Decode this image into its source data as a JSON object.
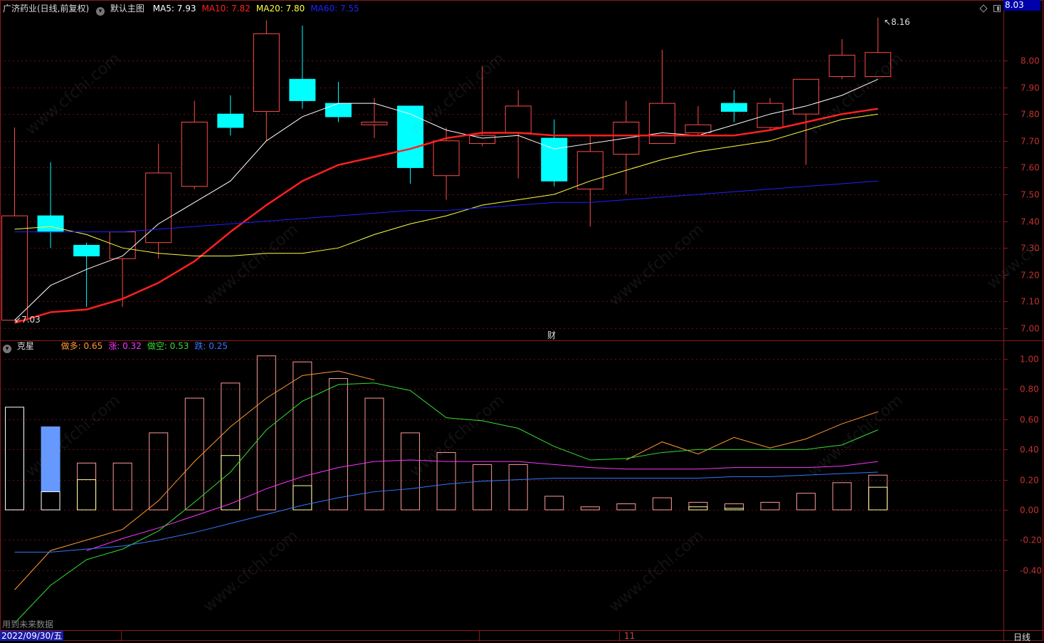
{
  "header": {
    "stock": "广济药业(日线,前复权)",
    "template_label": "默认主图",
    "ma": [
      {
        "label": "MA5: 7.93",
        "color": "#ffffff"
      },
      {
        "label": "MA10: 7.82",
        "color": "#ff2020"
      },
      {
        "label": "MA20: 7.80",
        "color": "#ffff40"
      },
      {
        "label": "MA60: 7.55",
        "color": "#2020ff"
      }
    ]
  },
  "sub_header": {
    "name": "克星",
    "items": [
      {
        "label": "做多: 0.65",
        "color": "#ff9933"
      },
      {
        "label": "涨: 0.32",
        "color": "#ff33ff"
      },
      {
        "label": "做空: 0.53",
        "color": "#33dd33"
      },
      {
        "label": "跌: 0.25",
        "color": "#3377ff"
      }
    ]
  },
  "markers": {
    "high_label": "8.16",
    "low_label": "7.03",
    "current_price": "8.03",
    "finance_mark": "财",
    "future_data_note": "用到未来数据",
    "date": "2022/09/30/五",
    "month_mark": "11",
    "period": "日线"
  },
  "chart_data": [
    {
      "type": "candlestick",
      "title": "广济药业(日线,前复权)",
      "ylim": [
        6.97,
        8.24
      ],
      "y_ticks": [
        "8.00",
        "7.90",
        "7.80",
        "7.70",
        "7.60",
        "7.50",
        "7.40",
        "7.30",
        "7.20",
        "7.10",
        "7.00"
      ],
      "candles": [
        {
          "o": 7.03,
          "h": 7.75,
          "l": 7.03,
          "c": 7.42
        },
        {
          "o": 7.42,
          "h": 7.62,
          "l": 7.3,
          "c": 7.36
        },
        {
          "o": 7.31,
          "h": 7.32,
          "l": 7.08,
          "c": 7.27
        },
        {
          "o": 7.26,
          "h": 7.36,
          "l": 7.08,
          "c": 7.36
        },
        {
          "o": 7.32,
          "h": 7.69,
          "l": 7.26,
          "c": 7.58
        },
        {
          "o": 7.53,
          "h": 7.85,
          "l": 7.52,
          "c": 7.77
        },
        {
          "o": 7.8,
          "h": 7.87,
          "l": 7.72,
          "c": 7.75
        },
        {
          "o": 7.81,
          "h": 8.15,
          "l": 7.7,
          "c": 8.1
        },
        {
          "o": 7.93,
          "h": 8.13,
          "l": 7.82,
          "c": 7.85
        },
        {
          "o": 7.84,
          "h": 7.92,
          "l": 7.77,
          "c": 7.79
        },
        {
          "o": 7.76,
          "h": 7.86,
          "l": 7.71,
          "c": 7.77
        },
        {
          "o": 7.83,
          "h": 7.83,
          "l": 7.54,
          "c": 7.6
        },
        {
          "o": 7.57,
          "h": 7.75,
          "l": 7.48,
          "c": 7.7
        },
        {
          "o": 7.69,
          "h": 7.98,
          "l": 7.68,
          "c": 7.72
        },
        {
          "o": 7.73,
          "h": 7.89,
          "l": 7.56,
          "c": 7.83
        },
        {
          "o": 7.71,
          "h": 7.78,
          "l": 7.53,
          "c": 7.55
        },
        {
          "o": 7.52,
          "h": 7.72,
          "l": 7.38,
          "c": 7.66
        },
        {
          "o": 7.65,
          "h": 7.85,
          "l": 7.5,
          "c": 7.77
        },
        {
          "o": 7.69,
          "h": 8.04,
          "l": 7.69,
          "c": 7.84
        },
        {
          "o": 7.73,
          "h": 7.83,
          "l": 7.72,
          "c": 7.76
        },
        {
          "o": 7.84,
          "h": 7.89,
          "l": 7.77,
          "c": 7.81
        },
        {
          "o": 7.75,
          "h": 7.86,
          "l": 7.74,
          "c": 7.84
        },
        {
          "o": 7.8,
          "h": 7.93,
          "l": 7.61,
          "c": 7.93
        },
        {
          "o": 7.94,
          "h": 8.08,
          "l": 7.93,
          "c": 8.02
        },
        {
          "o": 7.94,
          "h": 8.16,
          "l": 7.94,
          "c": 8.03
        }
      ],
      "ma": [
        {
          "name": "MA5",
          "color": "#ffffff",
          "width": 1,
          "values": [
            7.03,
            7.16,
            7.22,
            7.27,
            7.39,
            7.47,
            7.55,
            7.7,
            7.79,
            7.84,
            7.84,
            7.8,
            7.74,
            7.71,
            7.72,
            7.67,
            7.69,
            7.71,
            7.73,
            7.72,
            7.76,
            7.8,
            7.83,
            7.87,
            7.93
          ]
        },
        {
          "name": "MA10",
          "color": "#ff2020",
          "width": 2.5,
          "values": [
            7.02,
            7.06,
            7.07,
            7.11,
            7.17,
            7.25,
            7.36,
            7.46,
            7.55,
            7.61,
            7.64,
            7.67,
            7.71,
            7.73,
            7.73,
            7.72,
            7.72,
            7.72,
            7.72,
            7.72,
            7.72,
            7.74,
            7.77,
            7.8,
            7.82
          ]
        },
        {
          "name": "MA20",
          "color": "#ffff40",
          "width": 1,
          "values": [
            7.37,
            7.38,
            7.35,
            7.3,
            7.28,
            7.27,
            7.27,
            7.28,
            7.28,
            7.3,
            7.35,
            7.39,
            7.42,
            7.46,
            7.48,
            7.5,
            7.55,
            7.59,
            7.63,
            7.66,
            7.68,
            7.7,
            7.74,
            7.78,
            7.8
          ]
        },
        {
          "name": "MA60",
          "color": "#2020ff",
          "width": 1,
          "values": [
            7.36,
            7.36,
            7.36,
            7.36,
            7.37,
            7.38,
            7.39,
            7.4,
            7.41,
            7.42,
            7.43,
            7.44,
            7.44,
            7.45,
            7.46,
            7.47,
            7.47,
            7.48,
            7.49,
            7.5,
            7.51,
            7.52,
            7.53,
            7.54,
            7.55
          ]
        }
      ]
    },
    {
      "type": "bar+line",
      "title": "克星",
      "ylim": [
        -0.42,
        1.07
      ],
      "y_ticks": [
        "1.00",
        "0.80",
        "0.60",
        "0.40",
        "0.20",
        "0.00",
        "-0.20",
        "-0.40"
      ],
      "bars": [
        {
          "v": 0.68,
          "inner": null,
          "color": "#ffffff",
          "fill": false
        },
        {
          "v": 0.55,
          "inner": 0.12,
          "color": "#6699ff",
          "fill": true
        },
        {
          "v": 0.31,
          "inner": 0.2,
          "color": "#ff9999",
          "fill": false
        },
        {
          "v": 0.31,
          "inner": null,
          "color": "#ff9999",
          "fill": false
        },
        {
          "v": 0.51,
          "inner": null,
          "color": "#ff9999",
          "fill": false
        },
        {
          "v": 0.74,
          "inner": null,
          "color": "#ff9999",
          "fill": false
        },
        {
          "v": 0.84,
          "inner": 0.36,
          "color": "#ff9999",
          "fill": false
        },
        {
          "v": 1.02,
          "inner": null,
          "color": "#ff9999",
          "fill": false
        },
        {
          "v": 0.98,
          "inner": 0.16,
          "color": "#ff9999",
          "fill": false
        },
        {
          "v": 0.87,
          "inner": null,
          "color": "#ff9999",
          "fill": false
        },
        {
          "v": 0.74,
          "inner": null,
          "color": "#ff9999",
          "fill": false
        },
        {
          "v": 0.51,
          "inner": null,
          "color": "#ff9999",
          "fill": false
        },
        {
          "v": 0.38,
          "inner": null,
          "color": "#ff9999",
          "fill": false
        },
        {
          "v": 0.3,
          "inner": null,
          "color": "#ff9999",
          "fill": false
        },
        {
          "v": 0.3,
          "inner": null,
          "color": "#ff9999",
          "fill": false
        },
        {
          "v": 0.09,
          "inner": null,
          "color": "#ff9999",
          "fill": false
        },
        {
          "v": 0.02,
          "inner": null,
          "color": "#ff9999",
          "fill": false
        },
        {
          "v": 0.04,
          "inner": null,
          "color": "#ff9999",
          "fill": false
        },
        {
          "v": 0.08,
          "inner": null,
          "color": "#ff9999",
          "fill": false
        },
        {
          "v": 0.05,
          "inner": 0.02,
          "color": "#ff9999",
          "fill": false
        },
        {
          "v": 0.04,
          "inner": 0.01,
          "color": "#ff9999",
          "fill": false
        },
        {
          "v": 0.05,
          "inner": null,
          "color": "#ff9999",
          "fill": false
        },
        {
          "v": 0.11,
          "inner": null,
          "color": "#ff9999",
          "fill": false
        },
        {
          "v": 0.18,
          "inner": null,
          "color": "#ff9999",
          "fill": false
        },
        {
          "v": 0.23,
          "inner": 0.15,
          "color": "#ff9999",
          "fill": false
        }
      ],
      "series": [
        {
          "name": "做多",
          "color": "#ff9933",
          "values": [
            -0.53,
            -0.27,
            -0.2,
            -0.13,
            0.06,
            0.32,
            0.55,
            0.74,
            0.89,
            0.92,
            0.86,
            null,
            null,
            null,
            null,
            null,
            null,
            0.33,
            0.45,
            0.37,
            0.48,
            0.41,
            0.47,
            0.57,
            0.65
          ]
        },
        {
          "name": "涨",
          "color": "#ff33ff",
          "values": [
            null,
            null,
            -0.27,
            -0.19,
            -0.12,
            -0.04,
            0.04,
            0.14,
            0.22,
            0.28,
            0.32,
            0.33,
            0.32,
            0.32,
            0.32,
            0.3,
            0.28,
            0.27,
            0.27,
            0.27,
            0.28,
            0.28,
            0.28,
            0.29,
            0.32
          ]
        },
        {
          "name": "做空",
          "color": "#33dd33",
          "values": [
            -0.75,
            -0.5,
            -0.33,
            -0.26,
            -0.14,
            0.05,
            0.25,
            0.53,
            0.72,
            0.83,
            0.84,
            0.79,
            0.61,
            0.59,
            0.54,
            0.42,
            0.33,
            0.34,
            0.38,
            0.4,
            0.4,
            0.4,
            0.4,
            0.43,
            0.53
          ]
        },
        {
          "name": "跌",
          "color": "#3377ff",
          "values": [
            -0.28,
            -0.28,
            -0.26,
            -0.24,
            -0.2,
            -0.15,
            -0.09,
            -0.03,
            0.03,
            0.08,
            0.12,
            0.14,
            0.17,
            0.19,
            0.2,
            0.21,
            0.21,
            0.21,
            0.21,
            0.21,
            0.22,
            0.22,
            0.23,
            0.24,
            0.25
          ]
        }
      ]
    }
  ]
}
